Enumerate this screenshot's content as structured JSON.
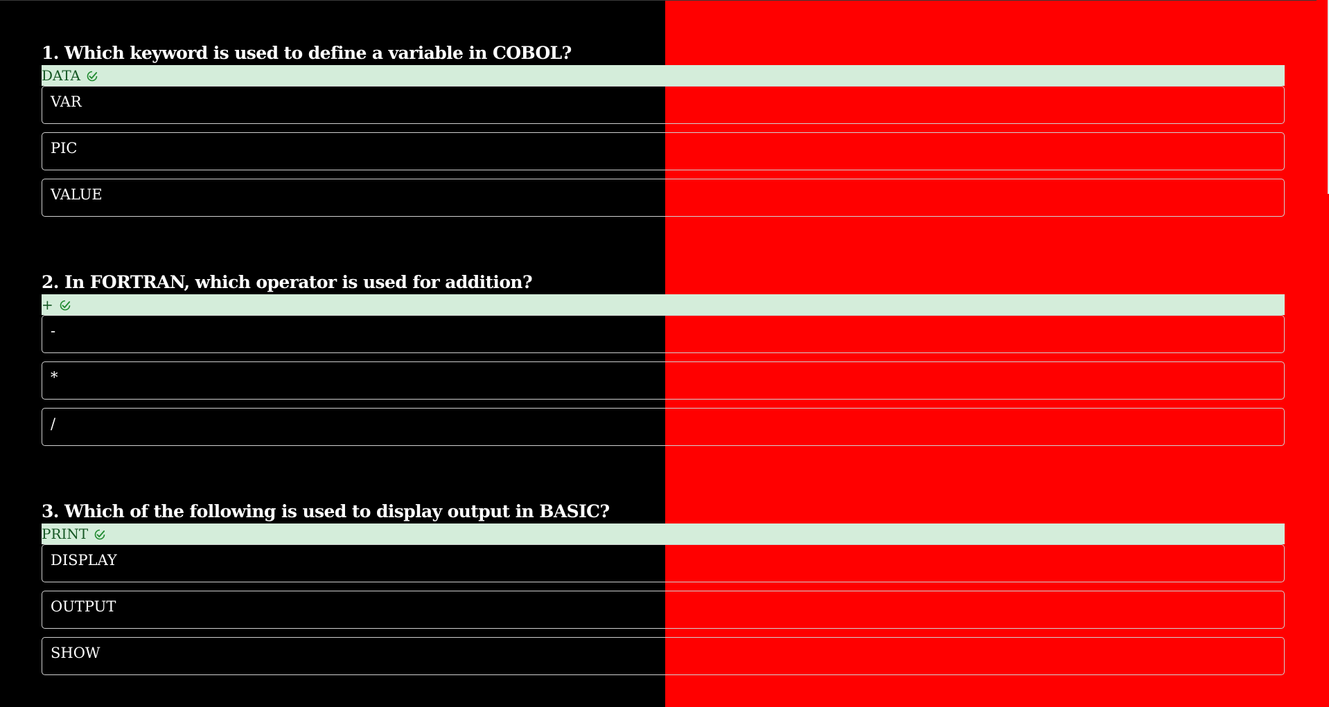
{
  "theme": {
    "left_bg": "#000000",
    "right_bg": "#ff0000",
    "correct_bg": "#d4edda",
    "correct_text": "#155724",
    "check_icon": "check-circle-icon"
  },
  "questions": [
    {
      "title": "1. Which keyword is used to define a variable in COBOL?",
      "correct_answer": "DATA",
      "options": [
        "VAR",
        "PIC",
        "VALUE"
      ]
    },
    {
      "title": "2. In FORTRAN, which operator is used for addition?",
      "correct_answer": "+",
      "options": [
        "-",
        "*",
        "/"
      ]
    },
    {
      "title": "3. Which of the following is used to display output in BASIC?",
      "correct_answer": "PRINT",
      "options": [
        "DISPLAY",
        "OUTPUT",
        "SHOW"
      ]
    }
  ]
}
